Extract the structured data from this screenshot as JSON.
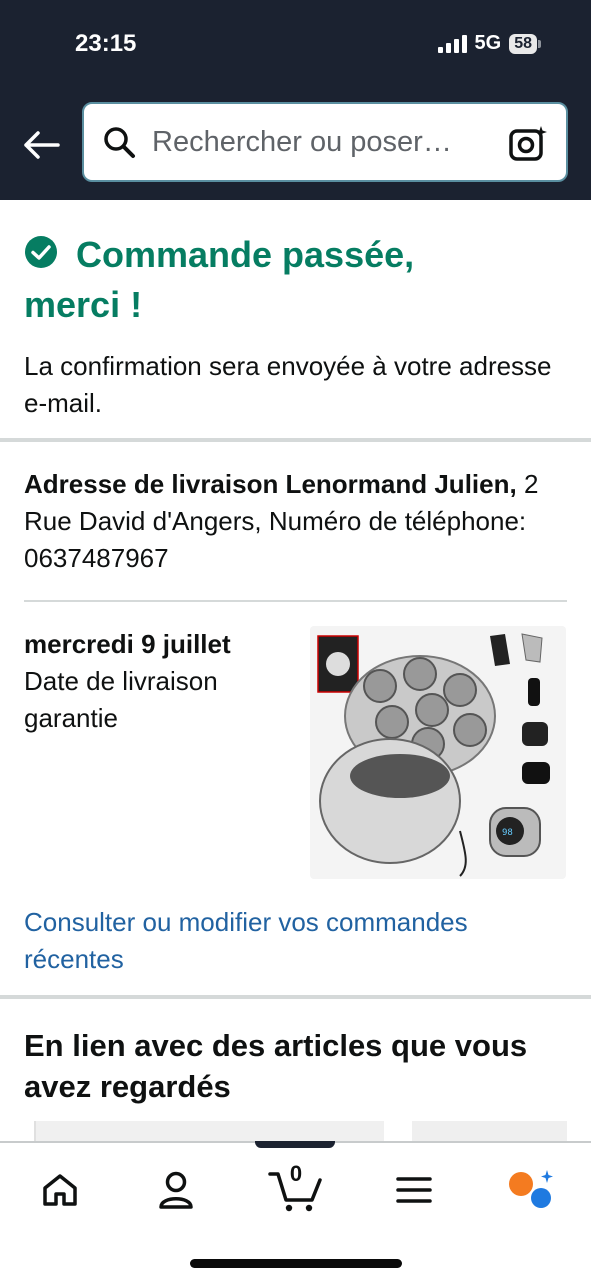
{
  "status_bar": {
    "time": "23:15",
    "network": "5G",
    "battery": "58"
  },
  "search": {
    "placeholder": "Rechercher ou poser…"
  },
  "confirmation": {
    "title_line1": "Commande passée,",
    "title_line2": "merci !",
    "message": "La confirmation sera envoyée à votre adresse e-mail."
  },
  "address": {
    "label": "Adresse de livraison Lenormand Julien,",
    "details": " 2 Rue David d'Angers, Numéro de téléphone: 0637487967"
  },
  "delivery": {
    "date": "mercredi 9 juillet",
    "note": "Date de livraison garantie"
  },
  "orders_link": "Consulter ou modifier vos commandes récentes",
  "related": {
    "title": "En lien avec des articles que vous avez regardés"
  },
  "bottom_nav": {
    "cart_count": "0"
  },
  "colors": {
    "accent_green": "#067d62",
    "link_blue": "#2162a1",
    "header_bg": "#1b2230"
  },
  "icons": [
    "back-arrow-icon",
    "search-icon",
    "camera-search-icon",
    "check-circle-icon",
    "home-icon",
    "account-icon",
    "cart-icon",
    "menu-icon",
    "rufus-ai-icon"
  ]
}
